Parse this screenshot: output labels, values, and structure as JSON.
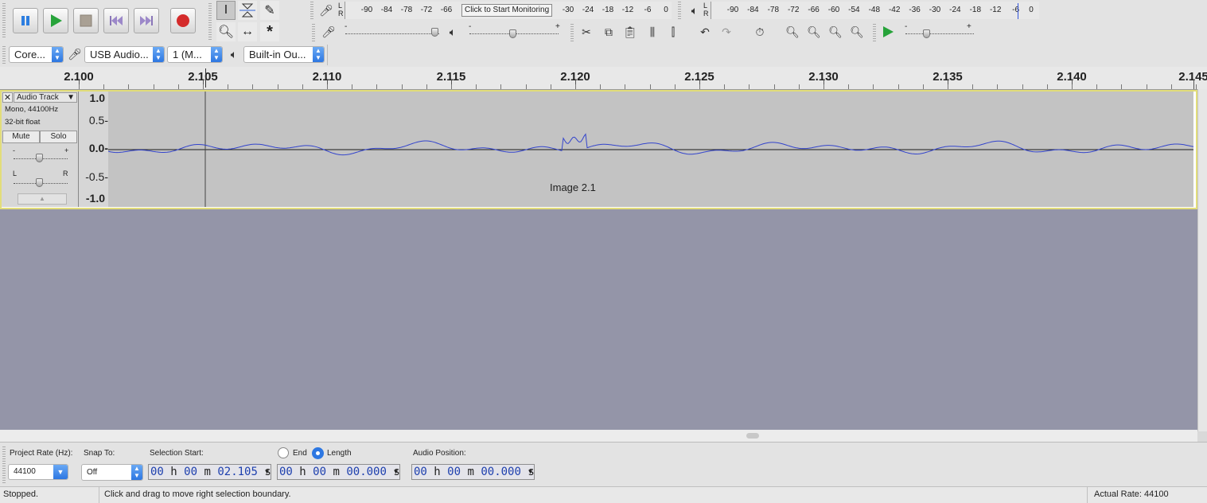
{
  "toolbar": {
    "transport": {
      "pause": "Pause",
      "play": "Play",
      "stop": "Stop",
      "skip_start": "Skip to Start",
      "skip_end": "Skip to End",
      "record": "Record"
    },
    "recording_meter": {
      "lr_top": "L",
      "lr_bottom": "R",
      "scale": [
        "-90",
        "-84",
        "-78",
        "-72",
        "-66",
        "-30",
        "-24",
        "-18",
        "-12",
        "-6",
        "0"
      ],
      "prompt": "Click to Start Monitoring"
    },
    "playback_meter": {
      "lr_top": "L",
      "lr_bottom": "R",
      "scale": [
        "-90",
        "-84",
        "-78",
        "-72",
        "-66",
        "-60",
        "-54",
        "-48",
        "-42",
        "-36",
        "-30",
        "-24",
        "-18",
        "-12",
        "-6",
        "0"
      ]
    },
    "mixer": {
      "minus": "-",
      "plus": "+"
    },
    "play_at_speed": {
      "minus": "-",
      "plus": "+"
    }
  },
  "device": {
    "host": "Core...",
    "input": "USB Audio...",
    "channels": "1 (M...",
    "output": "Built-in Ou..."
  },
  "ruler": {
    "ticks": [
      "2.100",
      "2.105",
      "2.110",
      "2.115",
      "2.120",
      "2.125",
      "2.130",
      "2.135",
      "2.140",
      "2.145"
    ]
  },
  "track": {
    "name": "Audio Track",
    "info1": "Mono, 44100Hz",
    "info2": "32-bit float",
    "mute": "Mute",
    "solo": "Solo",
    "gain_minus": "-",
    "gain_plus": "+",
    "pan_left": "L",
    "pan_right": "R",
    "scale": [
      "1.0",
      "0.5-",
      "0.0-",
      "-0.5-",
      "-1.0"
    ],
    "clip_label": "Image 2.1"
  },
  "selection_toolbar": {
    "project_rate_label": "Project Rate (Hz):",
    "project_rate": "44100",
    "snap_label": "Snap To:",
    "snap_value": "Off",
    "selection_start_label": "Selection Start:",
    "end_label": "End",
    "length_label": "Length",
    "length_selected": true,
    "selection_start": {
      "h": "00",
      "m": "00",
      "s": "02.105"
    },
    "length": {
      "h": "00",
      "m": "00",
      "s": "00.000"
    },
    "audio_position_label": "Audio Position:",
    "audio_position": {
      "h": "00",
      "m": "00",
      "s": "00.000"
    },
    "units": {
      "h": "h",
      "m": "m",
      "s": "s"
    }
  },
  "status": {
    "state": "Stopped.",
    "hint": "Click and drag to move right selection boundary.",
    "rate": "Actual Rate: 44100"
  },
  "colors": {
    "waveform": "#3344cc",
    "track_border": "#e2dd7a",
    "background_empty": "#9495a8",
    "time_digits": "#1d3fae"
  }
}
